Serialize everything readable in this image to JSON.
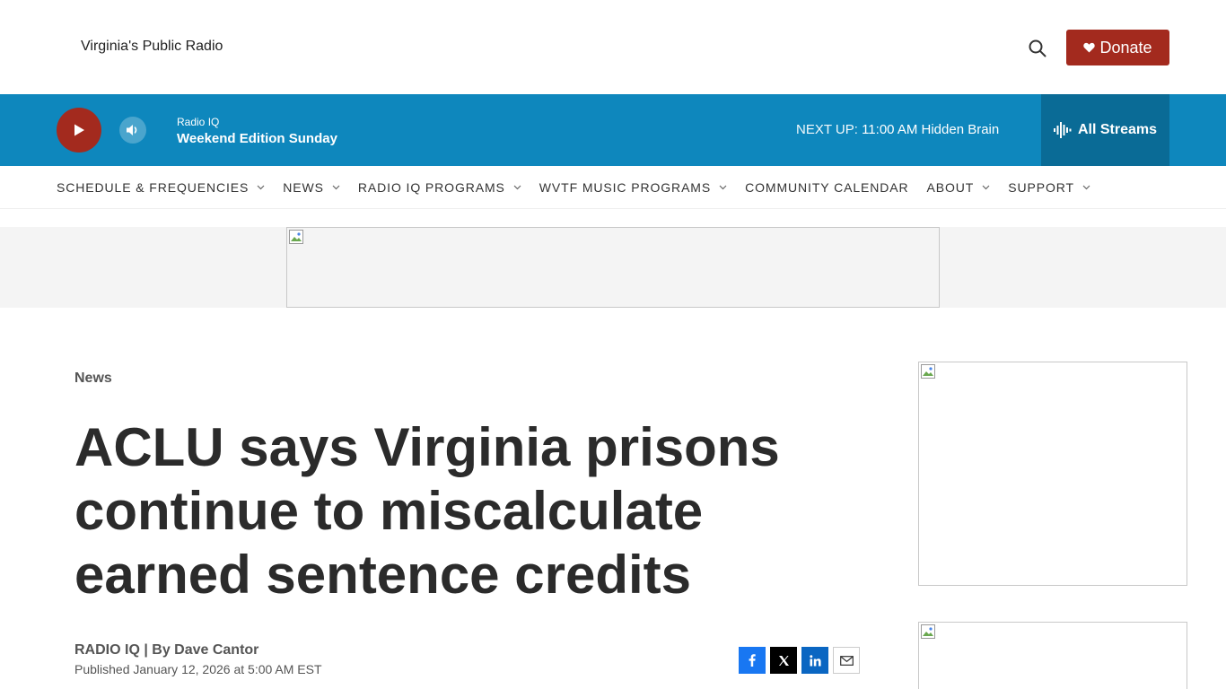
{
  "header": {
    "tagline": "Virginia's Public Radio",
    "search_icon": "search-icon",
    "donate_label": "Donate",
    "donate_icon": "heart-icon",
    "donate_color": "#a32a1e"
  },
  "player": {
    "station": "Radio IQ",
    "now_playing": "Weekend Edition Sunday",
    "next_up_label": "NEXT UP:",
    "next_up_time": "11:00 AM",
    "next_up_show": "Hidden Brain",
    "all_streams_label": "All Streams",
    "bar_color": "#0e87bd",
    "play_icon": "play-icon",
    "volume_icon": "volume-icon",
    "streams_icon": "audio-wave-icon"
  },
  "nav": {
    "items": [
      {
        "label": "SCHEDULE & FREQUENCIES",
        "has_dropdown": true
      },
      {
        "label": "NEWS",
        "has_dropdown": true
      },
      {
        "label": "RADIO IQ PROGRAMS",
        "has_dropdown": true
      },
      {
        "label": "WVTF MUSIC PROGRAMS",
        "has_dropdown": true
      },
      {
        "label": "COMMUNITY CALENDAR",
        "has_dropdown": false
      },
      {
        "label": "ABOUT",
        "has_dropdown": true
      },
      {
        "label": "SUPPORT",
        "has_dropdown": true
      }
    ]
  },
  "article": {
    "section": "News",
    "headline": "ACLU says Virginia prisons continue to miscalculate earned sentence credits",
    "source": "RADIO IQ",
    "byline_separator": " | By ",
    "author": "Dave Cantor",
    "published": "Published January 12, 2026 at 5:00 AM EST"
  },
  "share": {
    "icons": [
      "facebook-icon",
      "x-icon",
      "linkedin-icon",
      "email-icon"
    ]
  }
}
